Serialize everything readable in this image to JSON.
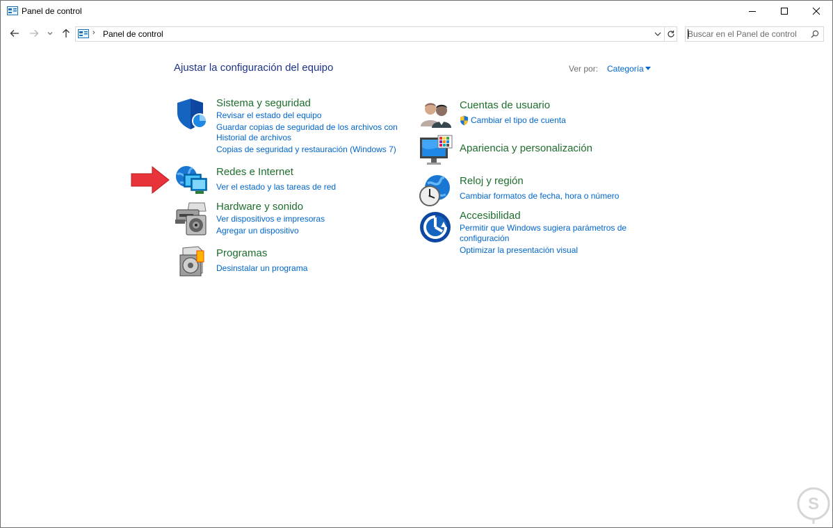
{
  "window": {
    "title": "Panel de control",
    "controls": [
      "minimize-icon",
      "maximize-icon",
      "close-icon"
    ]
  },
  "address_bar": {
    "path": "Panel de control",
    "separator": "›"
  },
  "search": {
    "placeholder": "Buscar en el Panel de control"
  },
  "main": {
    "heading": "Ajustar la configuración del equipo",
    "view_by_label": "Ver por:",
    "view_by_value": "Categoría"
  },
  "categories_left": [
    {
      "title": "Sistema y seguridad",
      "icon": "security-shield-icon",
      "links": [
        "Revisar el estado del equipo",
        "Guardar copias de seguridad de los archivos con",
        "Historial de archivos",
        "Copias de seguridad y restauración (Windows 7)"
      ]
    },
    {
      "title": "Redes e Internet",
      "icon": "network-globe-icon",
      "links": [
        "Ver el estado y las tareas de red"
      ]
    },
    {
      "title": "Hardware y sonido",
      "icon": "printer-speaker-icon",
      "links": [
        "Ver dispositivos e impresoras",
        "Agregar un dispositivo"
      ]
    },
    {
      "title": "Programas",
      "icon": "programs-disc-icon",
      "links": [
        "Desinstalar un programa"
      ]
    }
  ],
  "categories_right": [
    {
      "title": "Cuentas de usuario",
      "icon": "users-icon",
      "links": [
        "Cambiar el tipo de cuenta"
      ]
    },
    {
      "title": "Apariencia y personalización",
      "icon": "monitor-palette-icon",
      "links": []
    },
    {
      "title": "Reloj y región",
      "icon": "clock-globe-icon",
      "links": [
        "Cambiar formatos de fecha, hora o número"
      ]
    },
    {
      "title": "Accesibilidad",
      "icon": "accessibility-icon",
      "links": [
        "Permitir que Windows sugiera parámetros de",
        "configuración",
        "Optimizar la presentación visual"
      ]
    }
  ],
  "colors": {
    "heading": "#1e3287",
    "category_title": "#1e6e2d",
    "link": "#0066cc",
    "annotation_arrow": "#e8333a"
  }
}
